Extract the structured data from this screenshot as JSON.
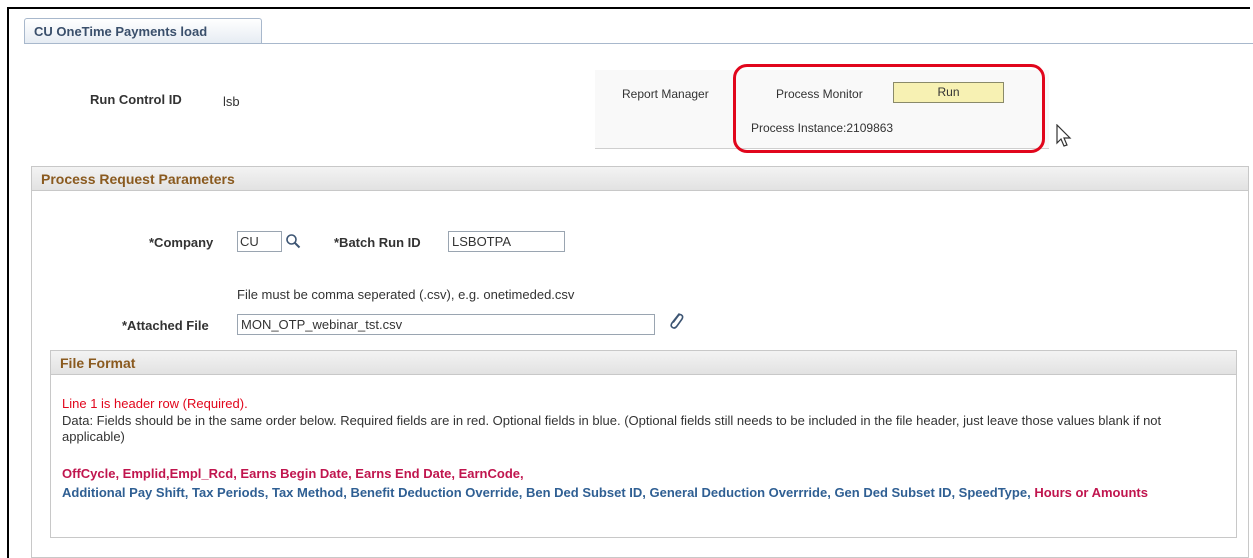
{
  "tab": {
    "label": "CU OneTime Payments load"
  },
  "run_control": {
    "label": "Run Control ID",
    "value": "lsb"
  },
  "run_panel": {
    "report_manager": "Report Manager",
    "process_monitor": "Process Monitor",
    "run_button": "Run",
    "process_instance": "Process Instance:2109863"
  },
  "params": {
    "title": "Process Request Parameters",
    "company_label": "*Company",
    "company_value": "CU",
    "batch_label": "*Batch Run ID",
    "batch_value": "LSBOTPA",
    "file_hint": "File must be comma seperated (.csv), e.g. onetimeded.csv",
    "attached_label": "*Attached File",
    "attached_value": "MON_OTP_webinar_tst.csv"
  },
  "file_format": {
    "title": "File Format",
    "line1": "Line 1 is header row (Required).",
    "data_text": "Data: Fields should be in the same order below. Required fields are in red. Optional fields in blue. (Optional fields still needs to be included in the file header, just leave those values blank if not applicable)",
    "required_fields_1": "OffCycle, Emplid,Empl_Rcd, Earns Begin Date, Earns End Date, EarnCode,",
    "optional_fields": "Additional Pay Shift, Tax Periods, Tax Method, Benefit Deduction Override, Ben Ded Subset ID, General Deduction Overrride, Gen Ded Subset ID, SpeedType,",
    "required_fields_2": "Hours or Amounts"
  },
  "colors": {
    "required": "#c0154e",
    "optional": "#2f5f93",
    "highlight": "#e1061c",
    "header_text": "#8a5a1f"
  },
  "icons": [
    "lookup-icon",
    "paperclip-icon",
    "mouse-cursor-icon"
  ]
}
